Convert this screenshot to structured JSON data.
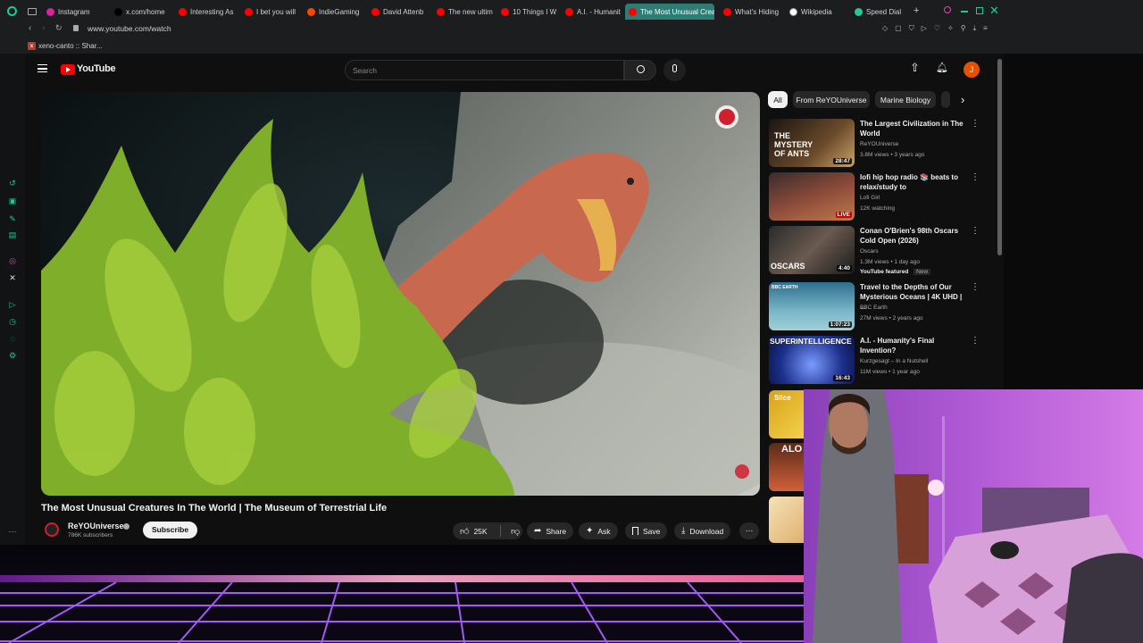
{
  "browser": {
    "tabs": [
      {
        "label": "Instagram",
        "color": "#d6249f"
      },
      {
        "label": "x.com/home",
        "color": "#000000"
      },
      {
        "label": "Interesting As",
        "color": "#ff0000"
      },
      {
        "label": "I bet you will",
        "color": "#ff0000"
      },
      {
        "label": "IndieGaming",
        "color": "#ff4500"
      },
      {
        "label": "David Attenb",
        "color": "#ff0000"
      },
      {
        "label": "The new ultim",
        "color": "#ff0000"
      },
      {
        "label": "10 Things I W",
        "color": "#ff0000"
      },
      {
        "label": "A.I. - Humanit",
        "color": "#ff0000"
      },
      {
        "label": "The Most Unusual Crea",
        "color": "#ff0000"
      },
      {
        "label": "What's Hiding",
        "color": "#ff0000"
      },
      {
        "label": "Wikipedia",
        "color": "#ffffff"
      },
      {
        "label": "Speed Dial",
        "color": "#20c997"
      }
    ],
    "url": "www.youtube.com/watch",
    "bookmark": "xeno-canto :: Shar..."
  },
  "yt": {
    "logo": "YouTube",
    "search_placeholder": "Search",
    "avatar_letter": "J",
    "video_title": "The Most Unusual Creatures In The World | The Museum of Terrestrial Life",
    "channel": {
      "name": "ReYOUniverse",
      "subs": "786K subscribers"
    },
    "subscribe": "Subscribe",
    "actions": {
      "likes": "25K",
      "share": "Share",
      "ask": "Ask",
      "save": "Save",
      "download": "Download"
    },
    "chips": [
      "All",
      "From ReYOUniverse",
      "Marine Biology"
    ],
    "recs": [
      {
        "title": "The Largest Civilization in The World",
        "channel": "ReYOUniverse",
        "meta": "3.8M views • 3 years ago",
        "badge": "28:47",
        "thumb_text": "THE MYSTERY OF ANTS"
      },
      {
        "title": "lofi hip hop radio 📚 beats to relax/study to",
        "channel": "Lofi Girl",
        "meta": "12K watching",
        "badge": "LIVE",
        "thumb_text": ""
      },
      {
        "title": "Conan O'Brien's 98th Oscars Cold Open (2026)",
        "channel": "Oscars",
        "meta": "1.3M views • 1 day ago",
        "extra": "YouTube featured",
        "extra2": "New",
        "badge": "4:40",
        "thumb_text": "OSCARS"
      },
      {
        "title": "Travel to the Depths of Our Mysterious Oceans | 4K UHD | ...",
        "channel": "BBC Earth",
        "meta": "27M views • 2 years ago",
        "badge": "1:07:23",
        "thumb_text": "BBC EARTH"
      },
      {
        "title": "A.I. - Humanity's Final Invention?",
        "channel": "Kurzgesagt – In a Nutshell",
        "meta": "11M views • 1 year ago",
        "badge": "16:43",
        "thumb_text": "SUPERINTELLIGENCE"
      }
    ],
    "partial_thumbs": [
      "Slice",
      "ALO"
    ]
  }
}
